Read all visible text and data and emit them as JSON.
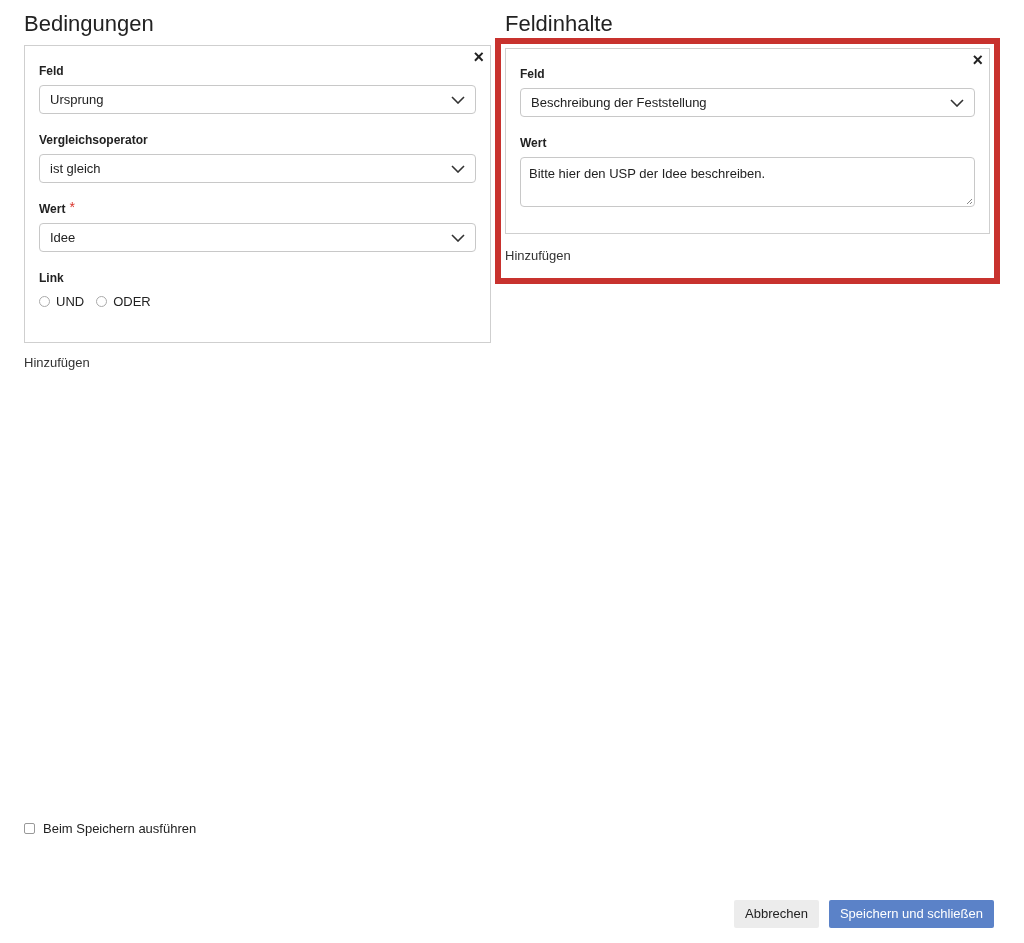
{
  "conditions": {
    "title": "Bedingungen",
    "card": {
      "fields": [
        {
          "kind": "select",
          "label": "Feld",
          "value": "Ursprung"
        },
        {
          "kind": "select",
          "label": "Vergleichsoperator",
          "value": "ist gleich"
        },
        {
          "kind": "select",
          "label": "Wert",
          "required_mark": "*",
          "value": "Idee"
        },
        {
          "kind": "radio",
          "label": "Link",
          "options": [
            {
              "label": "UND",
              "selected": false
            },
            {
              "label": "ODER",
              "selected": false
            }
          ]
        }
      ],
      "close": "×"
    },
    "add": "Hinzufügen"
  },
  "field_contents": {
    "title": "Feldinhalte",
    "highlighted": true,
    "card": {
      "fields": [
        {
          "kind": "select",
          "label": "Feld",
          "value": "Beschreibung der Feststellung"
        },
        {
          "kind": "textarea",
          "label": "Wert",
          "value": "Bitte hier den USP der Idee beschreiben."
        }
      ],
      "close": "×"
    },
    "add": "Hinzufügen"
  },
  "run_on_save": {
    "label": "Beim Speichern ausführen",
    "checked": false
  },
  "buttons": [
    {
      "kind": "secondary",
      "label": "Abbrechen"
    },
    {
      "kind": "primary",
      "label": "Speichern und schließen"
    }
  ]
}
